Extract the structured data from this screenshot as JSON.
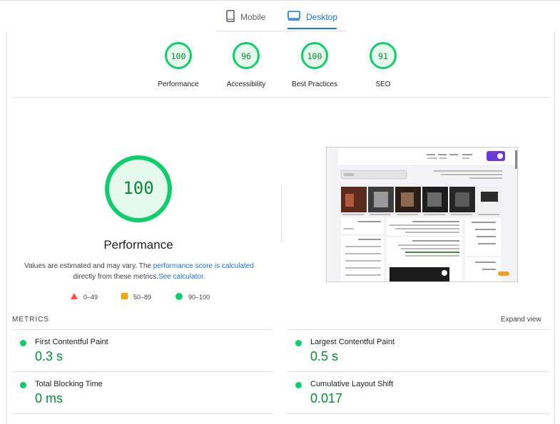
{
  "tabs": [
    {
      "label": "Mobile",
      "icon": "mobile-phone-icon",
      "selected": false
    },
    {
      "label": "Desktop",
      "icon": "desktop-monitor-icon",
      "selected": true
    }
  ],
  "scores": [
    {
      "value": "100",
      "label": "Performance"
    },
    {
      "value": "96",
      "label": "Accessibility"
    },
    {
      "value": "100",
      "label": "Best Practices"
    },
    {
      "value": "91",
      "label": "SEO"
    }
  ],
  "main": {
    "score": "100",
    "title": "Performance",
    "desc_prefix": "Values are estimated and may vary. The ",
    "desc_link1": "performance score is calculated",
    "desc_middle": " directly from these metrics.",
    "desc_link2": "See calculator."
  },
  "legend": [
    {
      "range": "0–49",
      "color": "#ff4e42",
      "shape": "triangle"
    },
    {
      "range": "50–89",
      "color": "#ffa400",
      "shape": "square"
    },
    {
      "range": "90–100",
      "color": "#0cce6b",
      "shape": "circle"
    }
  ],
  "metrics": {
    "title": "METRICS",
    "expand_label": "Expand view",
    "items": [
      {
        "label": "First Contentful Paint",
        "value": "0.3 s"
      },
      {
        "label": "Largest Contentful Paint",
        "value": "0.5 s"
      },
      {
        "label": "Total Blocking Time",
        "value": "0 ms"
      },
      {
        "label": "Cumulative Layout Shift",
        "value": "0.017"
      }
    ]
  },
  "colors": {
    "pass": "#0cce6b",
    "pass_text": "#0a8a34",
    "pass_fill": "#e6f9ed",
    "accent": "#1a73e8"
  }
}
